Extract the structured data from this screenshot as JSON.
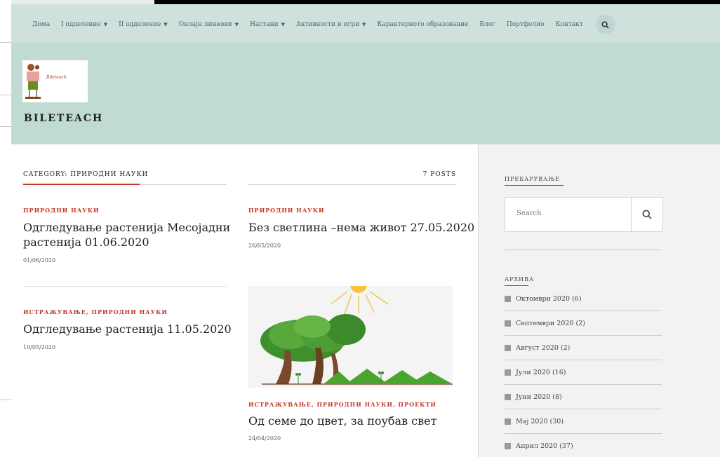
{
  "nav": {
    "items": [
      {
        "label": "Дома",
        "dropdown": false
      },
      {
        "label": "I одделение",
        "dropdown": true
      },
      {
        "label": "II одделение",
        "dropdown": true
      },
      {
        "label": "Онлајн линкови",
        "dropdown": true
      },
      {
        "label": "Настани",
        "dropdown": true
      },
      {
        "label": "Активности и игри",
        "dropdown": true
      },
      {
        "label": "Карактерното образование",
        "dropdown": false
      },
      {
        "label": "Блог",
        "dropdown": false
      },
      {
        "label": "Портфолио",
        "dropdown": false
      },
      {
        "label": "Контакт",
        "dropdown": false
      }
    ],
    "search_icon": "search-icon"
  },
  "header": {
    "site_title": "BILETEACH",
    "logo_text": "Bileteach"
  },
  "category": {
    "heading": "CATEGORY: ПРИРОДНИ НАУКИ",
    "count": "7 POSTS"
  },
  "posts": [
    {
      "category": "ПРИРОДНИ НАУКИ",
      "title_line1": "Одгледување растенија Месојадни",
      "title_line2": "растенија 01.06.2020",
      "date": "01/06/2020"
    },
    {
      "category": "ПРИРОДНИ НАУКИ",
      "title_line1": "Без светлина –нема живот 27.05.2020",
      "date": "26/05/2020"
    },
    {
      "category": "ИСТРАЖУВАЊЕ, ПРИРОДНИ НАУКИ",
      "title_line1": "Одгледување растенија 11.05.2020",
      "date": "10/05/2020"
    },
    {
      "category": "ИСТРАЖУВАЊЕ, ПРИРОДНИ НАУКИ, ПРОЕКТИ",
      "title_line1": "Од семе до цвет, за поубав свет",
      "date": "24/04/2020"
    }
  ],
  "sidebar": {
    "search_label": "ПРЕБАРУВАЊЕ",
    "search_placeholder": "Search",
    "archive_label": "АРХИВА",
    "archive": [
      "Октомври 2020 (6)",
      "Септември 2020 (2)",
      "Август 2020 (2)",
      "Јули 2020 (16)",
      "Јуни 2020 (8)",
      "Мај 2020 (30)",
      "Април 2020 (37)"
    ]
  },
  "colors": {
    "nav_bg": "#cfe1dd",
    "header_bg": "#bfdbd3",
    "accent": "#c0392b"
  }
}
